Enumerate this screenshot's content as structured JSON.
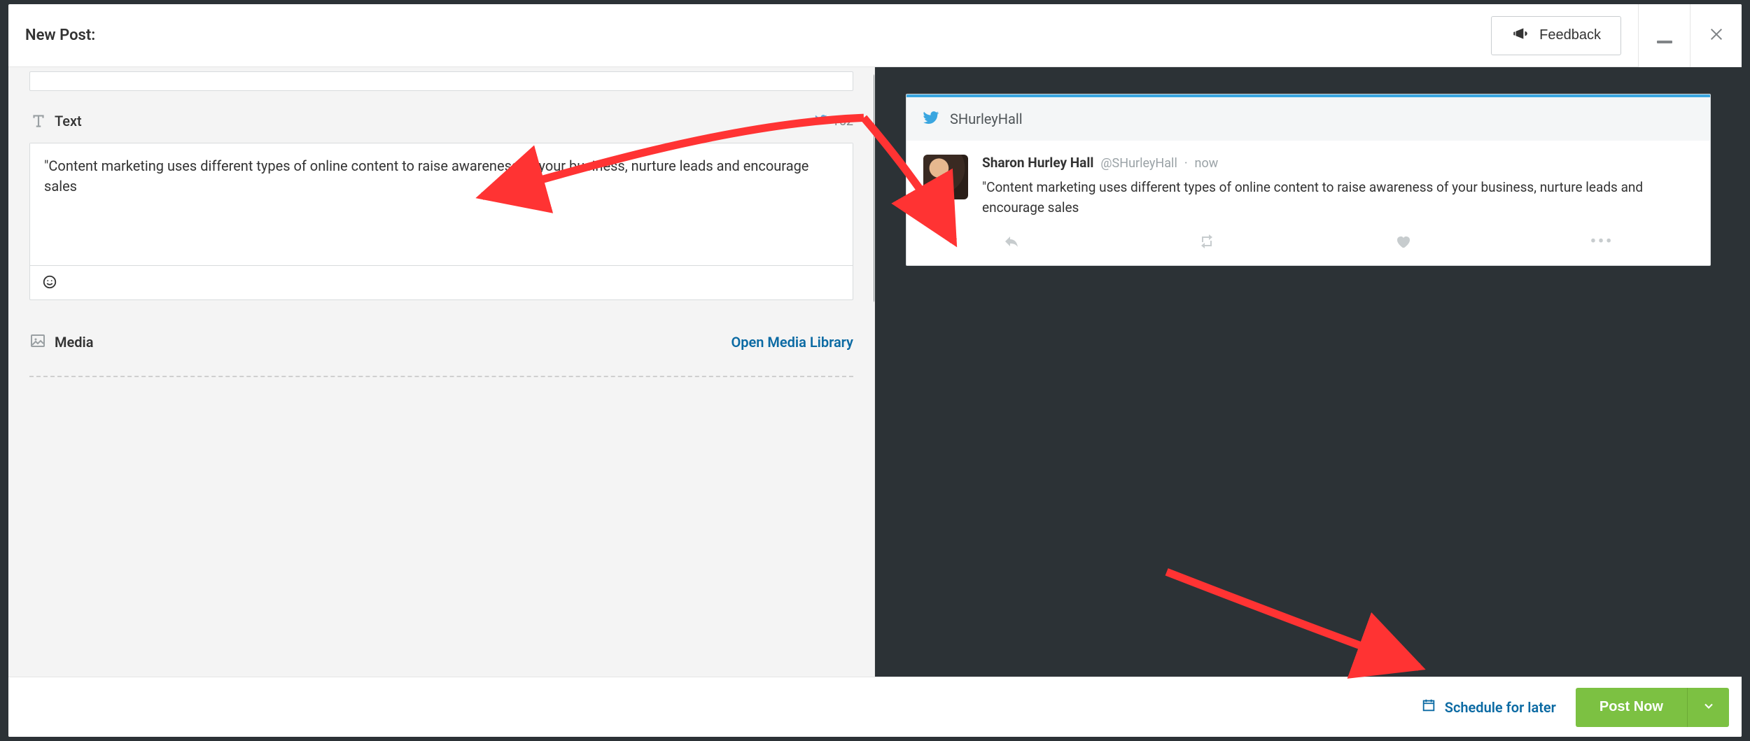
{
  "header": {
    "title": "New Post:",
    "feedback_label": "Feedback"
  },
  "composer": {
    "text_section_label": "Text",
    "char_counter": "152",
    "text_value": "\"Content marketing uses different types of online content to raise awareness of your business, nurture leads and encourage sales",
    "media_section_label": "Media",
    "open_media_library_label": "Open Media Library"
  },
  "preview": {
    "account_handle_header": "SHurleyHall",
    "display_name": "Sharon Hurley Hall",
    "handle": "@SHurleyHall",
    "separator": "·",
    "timestamp": "now",
    "tweet_text": "\"Content marketing uses different types of online content to raise awareness of your business, nurture leads and encourage sales"
  },
  "footer": {
    "schedule_label": "Schedule for later",
    "post_now_label": "Post Now"
  }
}
